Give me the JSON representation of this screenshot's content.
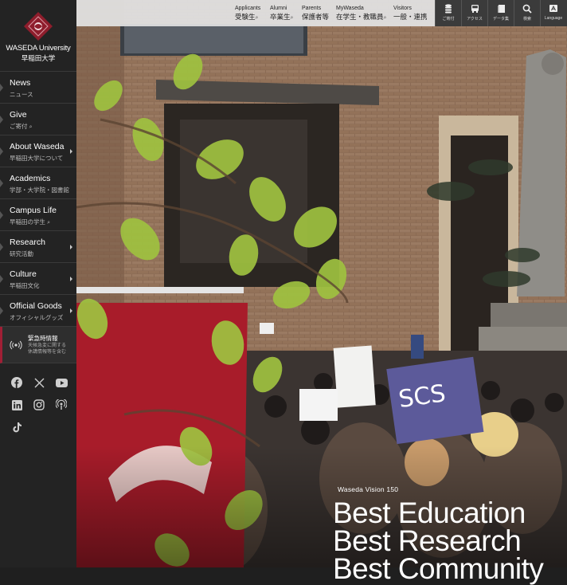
{
  "logo": {
    "name_en": "WASEDA University",
    "name_ja": "早稲田大学"
  },
  "sidebar": {
    "items": [
      {
        "en": "News",
        "ja": "ニュース",
        "has_submenu": false,
        "external": false
      },
      {
        "en": "Give",
        "ja": "ご寄付",
        "has_submenu": false,
        "external": true
      },
      {
        "en": "About Waseda",
        "ja": "早稲田大学について",
        "has_submenu": true,
        "external": false
      },
      {
        "en": "Academics",
        "ja": "学部・大学院・図書館",
        "has_submenu": false,
        "external": false
      },
      {
        "en": "Campus Life",
        "ja": "早稲田の学生",
        "has_submenu": false,
        "external": true
      },
      {
        "en": "Research",
        "ja": "研究活動",
        "has_submenu": true,
        "external": false
      },
      {
        "en": "Culture",
        "ja": "早稲田文化",
        "has_submenu": true,
        "external": false
      },
      {
        "en": "Official Goods",
        "ja": "オフィシャルグッズ",
        "has_submenu": true,
        "external": false
      }
    ],
    "emergency": {
      "title": "緊急時情報",
      "line1": "天候急変に関する",
      "line2": "休講情報等を含む",
      "accent": "#a01f35"
    },
    "social": [
      "facebook-icon",
      "x-icon",
      "youtube-icon",
      "linkedin-icon",
      "instagram-icon",
      "podcast-icon",
      "tiktok-icon"
    ]
  },
  "topnav": {
    "items": [
      {
        "en": "Applicants",
        "ja": "受験生",
        "ext": "⌕"
      },
      {
        "en": "Alumni",
        "ja": "卒業生",
        "ext": "⌕"
      },
      {
        "en": "Parents",
        "ja": "保護者等",
        "ext": ""
      },
      {
        "en": "MyWaseda",
        "ja": "在学生・教職員",
        "ext": "⌕"
      },
      {
        "en": "Visitors",
        "ja": "一般・連携",
        "ext": ""
      }
    ],
    "utilities": [
      {
        "label": "ご寄付",
        "icon": "coins-icon"
      },
      {
        "label": "アクセス",
        "icon": "bus-icon"
      },
      {
        "label": "データ集",
        "icon": "book-icon"
      },
      {
        "label": "検索",
        "icon": "search-icon"
      },
      {
        "label": "Language",
        "icon": "language-icon"
      }
    ]
  },
  "hero": {
    "vision": "Waseda Vision 150",
    "lines": [
      "Best Education",
      "Best Research",
      "Best Community"
    ]
  },
  "colors": {
    "brand": "#8e1d2c",
    "sidebar": "#232323"
  }
}
